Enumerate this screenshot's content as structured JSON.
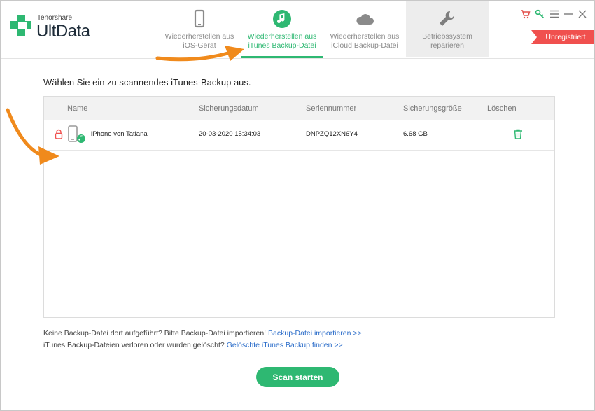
{
  "app": {
    "brand_small": "Tenorshare",
    "brand_name": "UltData"
  },
  "tabs": [
    {
      "line1": "Wiederherstellen aus",
      "line2": "iOS-Gerät",
      "icon": "phone-icon",
      "state": "normal"
    },
    {
      "line1": "Wiederherstellen aus",
      "line2": "iTunes Backup-Datei",
      "icon": "music-note-icon",
      "state": "active"
    },
    {
      "line1": "Wiederherstellen aus",
      "line2": "iCloud Backup-Datei",
      "icon": "cloud-icon",
      "state": "normal"
    },
    {
      "line1": "Betriebssystem",
      "line2": "reparieren",
      "icon": "wrench-icon",
      "state": "normal"
    }
  ],
  "window_controls": [
    "cart-icon",
    "key-icon",
    "menu-icon",
    "minimize-icon",
    "close-icon"
  ],
  "registration": "Unregistriert",
  "main": {
    "heading": "Wählen Sie ein zu scannendes iTunes-Backup aus.",
    "columns": [
      "Name",
      "Sicherungsdatum",
      "Seriennummer",
      "Sicherungsgröße",
      "Löschen"
    ],
    "rows": [
      {
        "name": "iPhone von Tatiana",
        "date": "20-03-2020 15:34:03",
        "serial": "DNPZQ12XN6Y4",
        "size": "6.68 GB"
      }
    ]
  },
  "footer": {
    "line1_text": "Keine Backup-Datei dort aufgeführt? Bitte Backup-Datei importieren!",
    "line1_link": "Backup-Datei importieren >>",
    "line2_text": "iTunes Backup-Dateien verloren oder wurden gelöscht?",
    "line2_link": "Gelöschte iTunes Backup finden >>"
  },
  "scan_button": "Scan starten",
  "colors": {
    "accent": "#2eb872",
    "danger": "#f0504e",
    "link": "#2a6cc9",
    "annotation": "#f08a1c"
  }
}
